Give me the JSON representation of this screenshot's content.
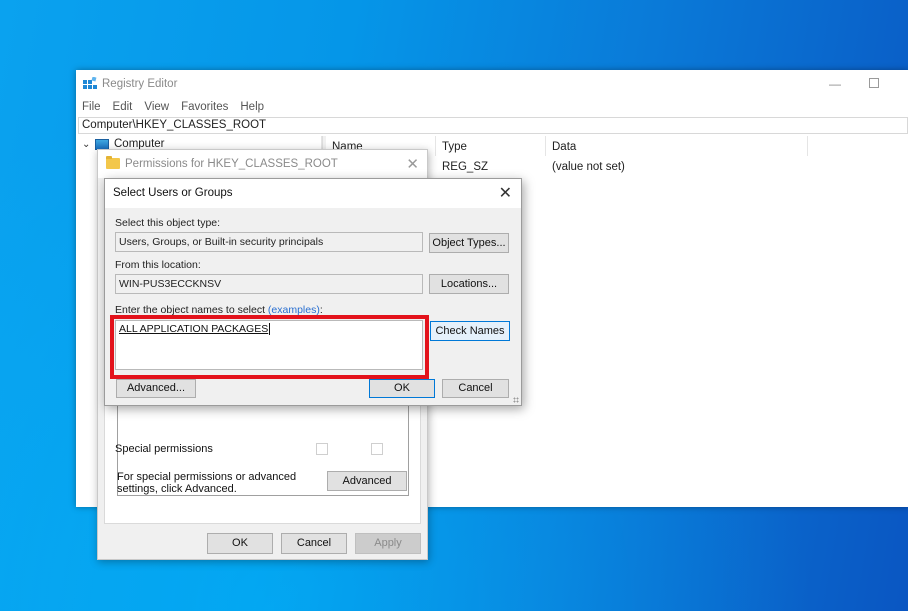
{
  "desktop": {
    "background_colors": [
      "#0aa2ef",
      "#0a56c2"
    ]
  },
  "registry_editor": {
    "title": "Registry Editor",
    "menu": [
      "File",
      "Edit",
      "View",
      "Favorites",
      "Help"
    ],
    "address": "Computer\\HKEY_CLASSES_ROOT",
    "tree": {
      "root_label": "Computer",
      "expanded": true
    },
    "list": {
      "columns": [
        "Name",
        "Type",
        "Data"
      ],
      "rows": [
        {
          "name": "",
          "type": "REG_SZ",
          "data": "(value not set)"
        }
      ]
    }
  },
  "permissions_dialog": {
    "title": "Permissions for HKEY_CLASSES_ROOT",
    "special_permissions_label": "Special permissions",
    "note": "For special permissions or advanced settings, click Advanced.",
    "buttons": {
      "advanced": "Advanced",
      "ok": "OK",
      "cancel": "Cancel",
      "apply": "Apply"
    }
  },
  "select_dialog": {
    "title": "Select Users or Groups",
    "object_type_label": "Select this object type:",
    "object_type_value": "Users, Groups, or Built-in security principals",
    "location_label": "From this location:",
    "location_value": "WIN-PUS3ECCKNSV",
    "enter_label": "Enter the object names to select",
    "examples_link": "(examples)",
    "enter_suffix": ":",
    "names_value": "ALL APPLICATION PACKAGES",
    "buttons": {
      "object_types": "Object Types...",
      "locations": "Locations...",
      "check_names": "Check Names",
      "advanced": "Advanced...",
      "ok": "OK",
      "cancel": "Cancel"
    }
  },
  "annotation": {
    "highlight_color": "#e3121b"
  }
}
